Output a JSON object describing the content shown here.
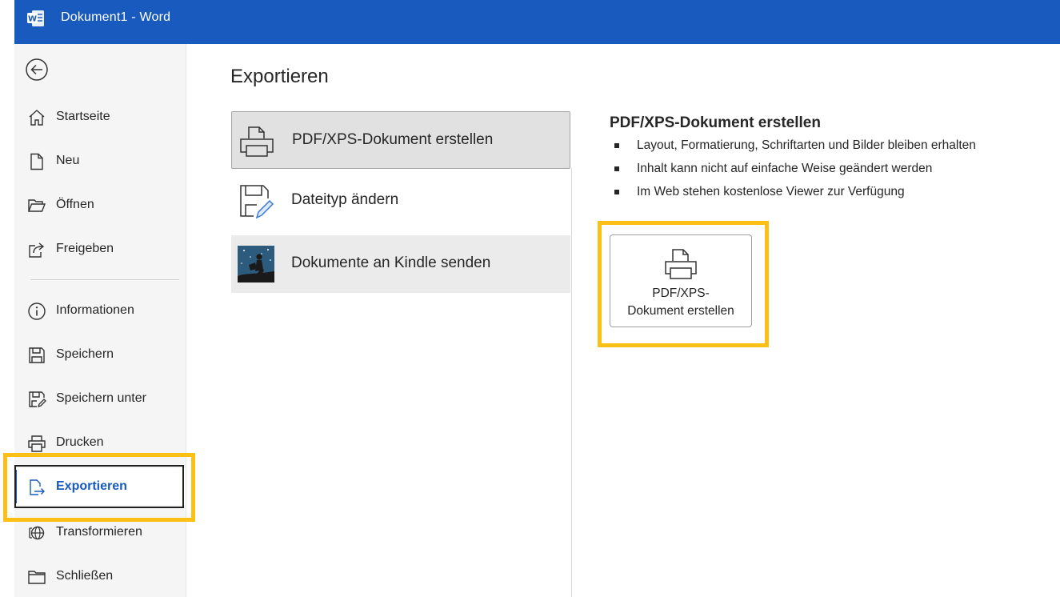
{
  "window": {
    "doc_name": "Dokument1",
    "separator": " - ",
    "app_name": "Word"
  },
  "colors": {
    "accent": "#185abd",
    "highlight": "#fbbf15"
  },
  "sidebar": {
    "items": [
      {
        "label": "Startseite",
        "icon": "home-icon"
      },
      {
        "label": "Neu",
        "icon": "new-document-icon"
      },
      {
        "label": "Öffnen",
        "icon": "folder-open-icon"
      },
      {
        "label": "Freigeben",
        "icon": "share-icon"
      },
      {
        "label": "Informationen",
        "icon": "info-icon"
      },
      {
        "label": "Speichern",
        "icon": "save-icon"
      },
      {
        "label": "Speichern unter",
        "icon": "save-as-icon"
      },
      {
        "label": "Drucken",
        "icon": "printer-icon"
      },
      {
        "label": "Exportieren",
        "icon": "export-icon",
        "selected": true
      },
      {
        "label": "Transformieren",
        "icon": "transform-icon"
      },
      {
        "label": "Schließen",
        "icon": "close-folder-icon"
      }
    ]
  },
  "main": {
    "title": "Exportieren",
    "options": [
      {
        "label": "PDF/XPS-Dokument erstellen",
        "icon": "pdf-xps-icon",
        "selected": true
      },
      {
        "label": "Dateityp ändern",
        "icon": "change-filetype-icon"
      },
      {
        "label": "Dokumente an Kindle senden",
        "icon": "kindle-icon"
      }
    ],
    "detail": {
      "title": "PDF/XPS-Dokument erstellen",
      "bullets": [
        "Layout, Formatierung, Schriftarten und Bilder bleiben erhalten",
        "Inhalt kann nicht auf einfache Weise geändert werden",
        "Im Web stehen kostenlose Viewer zur Verfügung"
      ],
      "button": {
        "line1": "PDF/XPS-",
        "line2": "Dokument erstellen"
      }
    }
  }
}
